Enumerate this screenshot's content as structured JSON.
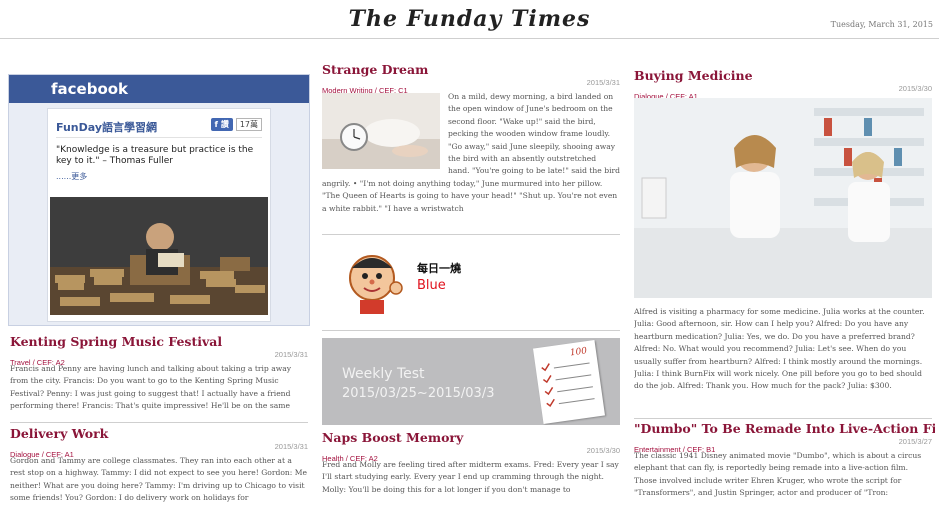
{
  "header": {
    "title": "The Funday Times",
    "date": "Tuesday, March 31, 2015"
  },
  "facebook": {
    "brand": "facebook",
    "page_name": "FunDay語言學習網",
    "like_label": "讚",
    "like_count": "17萬",
    "quote": "\"Knowledge is a treasure but practice is the key to it.\" – Thomas Fuller",
    "more": "......更多"
  },
  "articles": {
    "kenting": {
      "title": "Kenting Spring Music Festival",
      "category": "Travel / CEF: A2",
      "date": "2015/3/31",
      "body": "Francis and Penny are having lunch and talking about taking a trip away from the city. Francis: Do you want to go to the Kenting Spring Music Festival? Penny: I was just going to suggest that! I actually have a friend performing there! Francis: That's quite impressive! He'll be on the same"
    },
    "delivery": {
      "title": "Delivery Work",
      "category": "Dialogue / CEF: A1",
      "date": "2015/3/31",
      "body": "Gordon and Tammy are college classmates. They ran into each other at a rest stop on a highway. Tammy: I did not expect to see you here! Gordon: Me neither! What are you doing here? Tammy: I'm driving up to Chicago to visit some friends! You? Gordon: I do delivery work on holidays for"
    },
    "dream": {
      "title": "Strange Dream",
      "category": "Modern Writing / CEF: C1",
      "date": "2015/3/31",
      "body": "On a mild, dewy morning, a bird landed on the open window of June's bedroom on the second floor. \"Wake up!\" said the bird, pecking the wooden window frame loudly. \"Go away,\" said June sleepily, shooing away the bird with an absently outstretched hand. \"You're going to be late!\" said the bird angrily. • \"I'm not doing anything today,\" June murmured into her pillow. \"The Queen of Hearts is going to have your head!\" \"Shut up. You're not even a white rabbit.\" \"I have a wristwatch"
    },
    "naps": {
      "title": "Naps Boost Memory",
      "category": "Health / CEF: A2",
      "date": "2015/3/30",
      "body": "Fred and Molly are feeling tired after midterm exams. Fred: Every year I say I'll start studying early. Every year I end up cramming through the night. Molly: You'll be doing this for a lot longer if you don't manage to"
    },
    "medicine": {
      "title": "Buying Medicine",
      "category": "Dialogue / CEF: A1",
      "date": "2015/3/30",
      "body": "Alfred is visiting a pharmacy for some medicine. Julia works at the counter. Julia: Good afternoon, sir. How can I help you? Alfred: Do you have any heartburn medication? Julia: Yes, we do. Do you have a preferred brand? Alfred: No. What would you recommend? Julia: Let's see. When do you usually suffer from heartburn? Alfred: I think mostly around the mornings. Julia: I think BurnFix will work nicely. One pill before you go to bed should do the job. Alfred: Thank you. How much for the pack? Julia: $300."
    },
    "dumbo": {
      "title": "\"Dumbo\" To Be Remade Into Live-Action Film",
      "category": "Entertainment / CEF: B1",
      "date": "2015/3/27",
      "body": "The classic 1941 Disney animated movie \"Dumbo\", which is about a circus elephant that can fly, is reportedly being remade into a live-action film. Those involved include writer Ehren Kruger, who wrote the script for \"Transformers\", and Justin Springer, actor and producer of \"Tron:"
    }
  },
  "daily": {
    "label": "每日一燒",
    "word": "Blue"
  },
  "weekly": {
    "title": "Weekly Test",
    "range": "2015/03/25~2015/03/3",
    "score": "100"
  },
  "colors": {
    "title": "#8a1538",
    "category": "#a4123f",
    "facebook": "#3b5998",
    "daily_word": "#e0121d"
  }
}
